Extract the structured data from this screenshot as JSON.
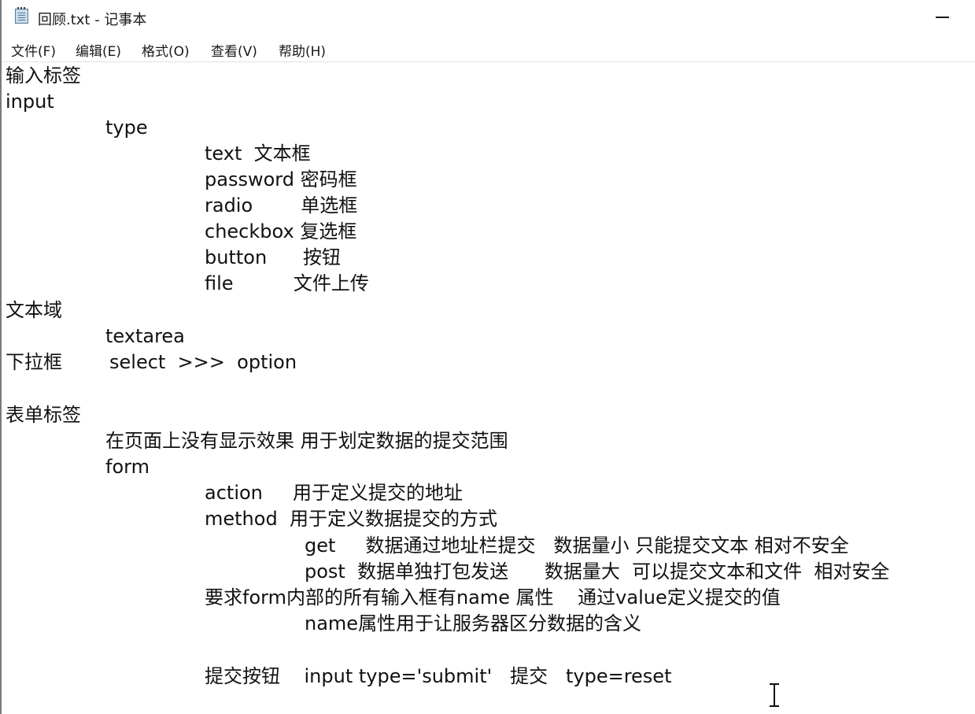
{
  "window": {
    "title": "回顾.txt - 记事本"
  },
  "menu": {
    "items": [
      {
        "label": "文件(F)"
      },
      {
        "label": "编辑(E)"
      },
      {
        "label": "格式(O)"
      },
      {
        "label": "查看(V)"
      },
      {
        "label": "帮助(H)"
      }
    ]
  },
  "editor": {
    "lines": [
      "输入标签",
      "input",
      "type",
      "text  文本框",
      "password 密码框",
      "radio        单选框",
      "checkbox 复选框",
      "button      按钮",
      "file          文件上传",
      "文本域",
      "textarea",
      "下拉框",
      "select  >>>  option",
      "表单标签",
      "在页面上没有显示效果 用于划定数据的提交范围",
      "form",
      "action     用于定义提交的地址",
      "method  用于定义数据提交的方式",
      "get     数据通过地址栏提交   数据量小 只能提交文本 相对不安全",
      "post  数据单独打包发送      数据量大  可以提交文本和文件  相对安全",
      "要求form内部的所有输入框有name 属性    通过value定义提交的值",
      "name属性用于让服务器区分数据的含义",
      "提交按钮    input type='submit'   提交   type=reset"
    ]
  }
}
